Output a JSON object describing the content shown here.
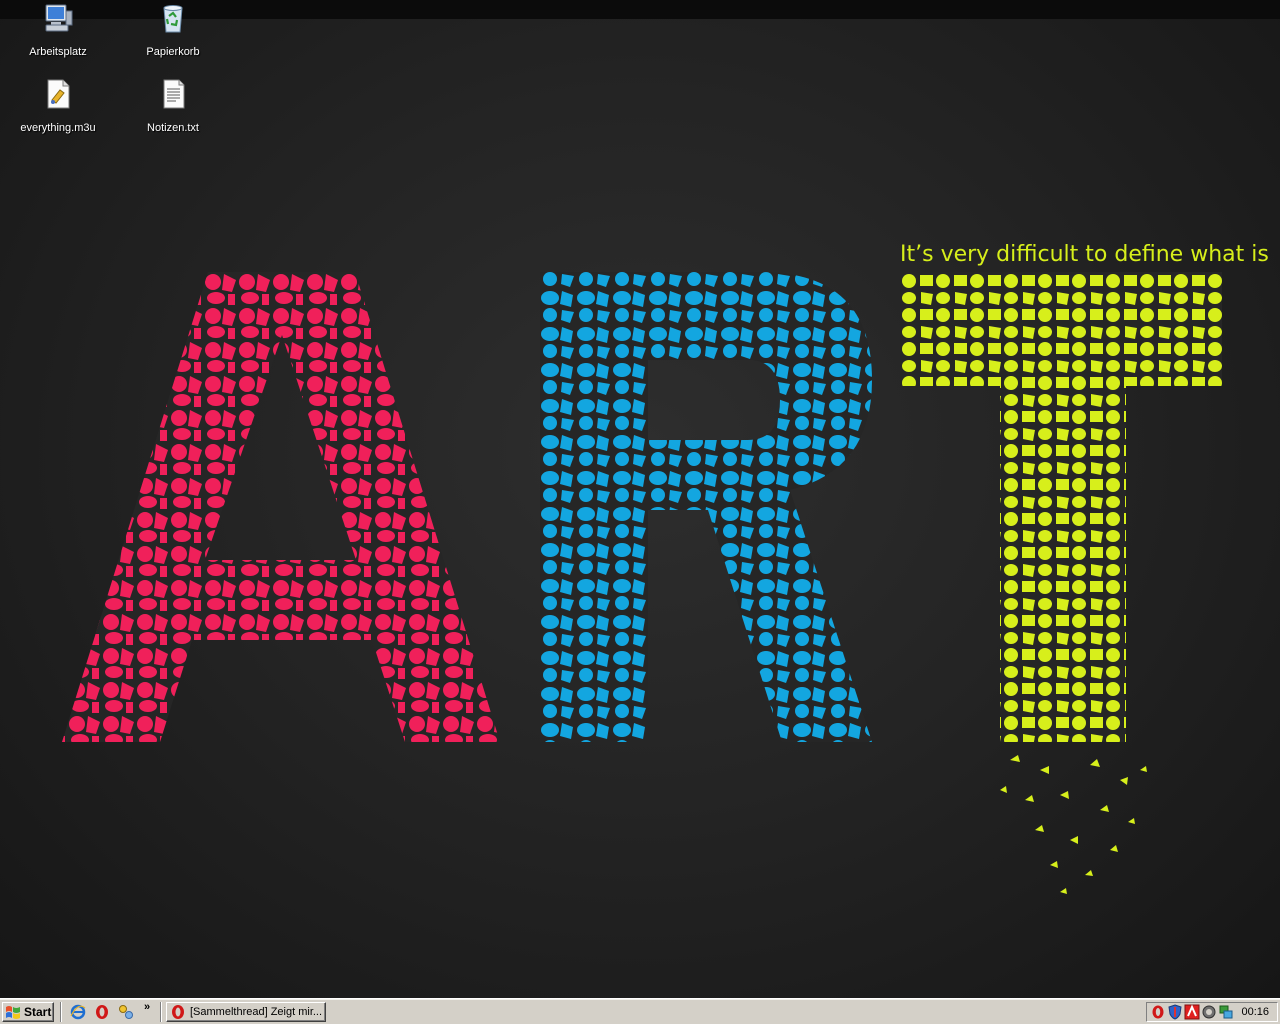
{
  "desktop": {
    "icons": [
      {
        "label": "Arbeitsplatz",
        "icon": "my-computer-icon"
      },
      {
        "label": "Papierkorb",
        "icon": "recycle-bin-icon"
      },
      {
        "label": "everything.m3u",
        "icon": "playlist-file-icon"
      },
      {
        "label": "Notizen.txt",
        "icon": "text-file-icon"
      }
    ]
  },
  "wallpaper": {
    "letters": [
      "A",
      "R",
      "T"
    ],
    "tagline": "It’s very difficult to define what is",
    "colors": {
      "a": "#f0205a",
      "r": "#13a6e0",
      "t": "#d7ef1b",
      "background": "#262626"
    }
  },
  "taskbar": {
    "start_label": "Start",
    "quick_launch": [
      "ie-icon",
      "opera-icon",
      "network-icon"
    ],
    "chevron": "»",
    "window_button": "[Sammelthread] Zeigt mir...",
    "tray_icons": [
      "opera-tray-icon",
      "shield-icon",
      "antivir-icon",
      "volume-icon",
      "network-tray-icon"
    ],
    "clock": "00:16"
  }
}
